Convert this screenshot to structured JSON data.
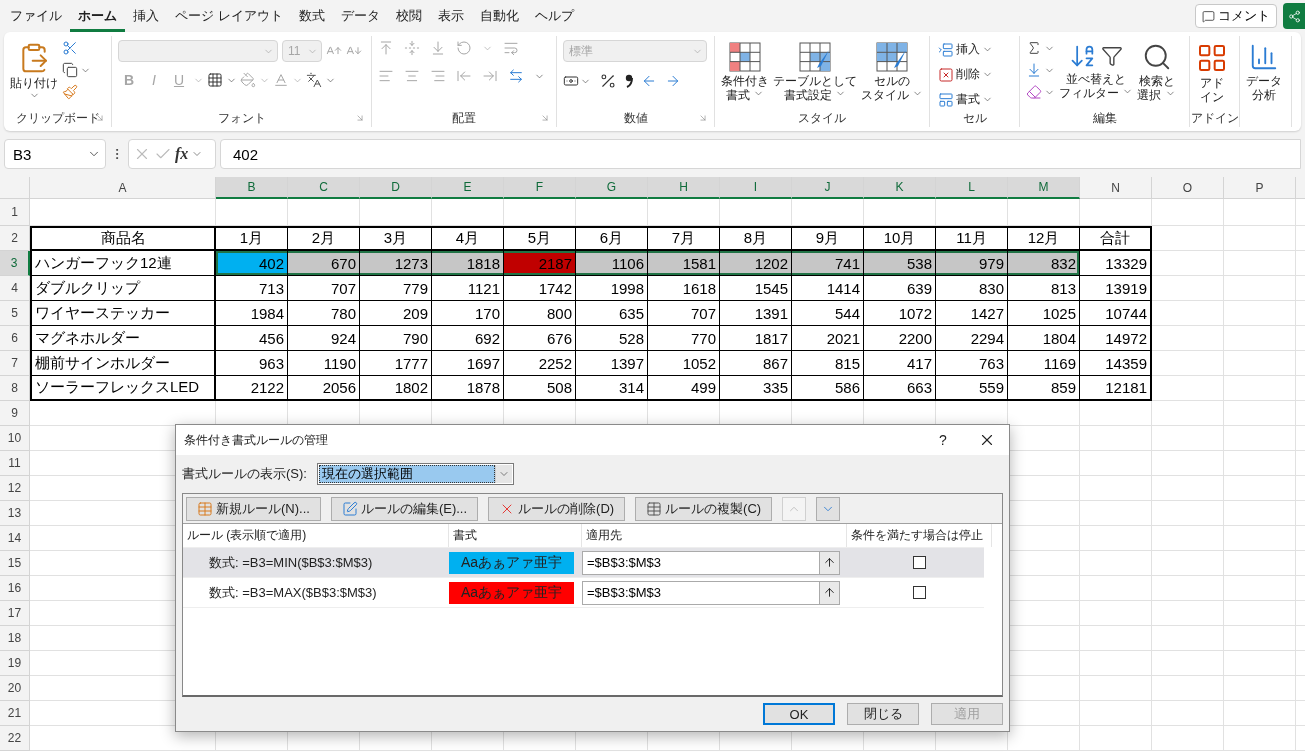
{
  "menu_tabs": [
    {
      "label": "ファイル",
      "selected": false
    },
    {
      "label": "ホーム",
      "selected": true
    },
    {
      "label": "挿入",
      "selected": false
    },
    {
      "label": "ページ レイアウト",
      "selected": false
    },
    {
      "label": "数式",
      "selected": false
    },
    {
      "label": "データ",
      "selected": false
    },
    {
      "label": "校閲",
      "selected": false
    },
    {
      "label": "表示",
      "selected": false
    },
    {
      "label": "自動化",
      "selected": false
    },
    {
      "label": "ヘルプ",
      "selected": false
    }
  ],
  "comment_button": "コメント",
  "ribbon": {
    "clipboard": {
      "paste": "貼り付け",
      "label": "クリップボード"
    },
    "font": {
      "disabled": true,
      "size": "11",
      "bold": "B",
      "italic": "I",
      "underline": "U",
      "label": "フォント"
    },
    "alignment": {
      "disabled": true,
      "label": "配置"
    },
    "number": {
      "format": "標準",
      "format_disabled": true,
      "label": "数値"
    },
    "styles": {
      "buttons": [
        {
          "kind": "conditional",
          "lines": [
            "条件付き",
            "書式"
          ]
        },
        {
          "kind": "table",
          "lines": [
            "テーブルとして",
            "書式設定"
          ]
        },
        {
          "kind": "cellstyle",
          "lines": [
            "セルの",
            "スタイル"
          ]
        }
      ],
      "label": "スタイル"
    },
    "cells": {
      "buttons": [
        {
          "kind": "insert",
          "label": "挿入"
        },
        {
          "kind": "delete",
          "label": "削除"
        },
        {
          "kind": "format",
          "label": "書式"
        }
      ],
      "label": "セル"
    },
    "editing": {
      "buttons": [
        {
          "kind": "sort",
          "lines": [
            "並べ替えと",
            "フィルター"
          ]
        },
        {
          "kind": "find",
          "lines": [
            "検索と",
            "選択"
          ]
        }
      ],
      "label": "編集"
    },
    "addins": {
      "buttons": [
        {
          "kind": "addin",
          "lines": [
            "アド",
            "イン"
          ]
        }
      ],
      "label": "アドイン"
    },
    "analysis": {
      "buttons": [
        {
          "kind": "analysis",
          "lines": [
            "データ",
            "分析"
          ]
        }
      ]
    }
  },
  "formula_bar": {
    "name_box": "B3",
    "fx": "fx",
    "value": "402"
  },
  "sheet": {
    "columns": [
      {
        "label": "A",
        "selected": false
      },
      {
        "label": "B",
        "selected": true
      },
      {
        "label": "C",
        "selected": true
      },
      {
        "label": "D",
        "selected": true
      },
      {
        "label": "E",
        "selected": true
      },
      {
        "label": "F",
        "selected": true
      },
      {
        "label": "G",
        "selected": true
      },
      {
        "label": "H",
        "selected": true
      },
      {
        "label": "I",
        "selected": true
      },
      {
        "label": "J",
        "selected": true
      },
      {
        "label": "K",
        "selected": true
      },
      {
        "label": "L",
        "selected": true
      },
      {
        "label": "M",
        "selected": true
      },
      {
        "label": "N",
        "selected": false
      },
      {
        "label": "O",
        "selected": false
      },
      {
        "label": "P",
        "selected": false
      }
    ],
    "rows": [
      {
        "number": "1",
        "kind": "empty",
        "selected": false,
        "cells": []
      },
      {
        "number": "2",
        "kind": "header",
        "selected": false,
        "cells": [
          "商品名",
          "1月",
          "2月",
          "3月",
          "4月",
          "5月",
          "6月",
          "7月",
          "8月",
          "9月",
          "10月",
          "11月",
          "12月",
          "合計"
        ]
      },
      {
        "number": "3",
        "kind": "data",
        "selected": true,
        "cells": [
          "ハンガーフック12連",
          {
            "text": "402",
            "color": "#00b0f0"
          },
          "670",
          "1273",
          "1818",
          {
            "text": "2187",
            "color": "#c00000"
          },
          "1106",
          "1581",
          "1202",
          "741",
          "538",
          "979",
          "832",
          "13329"
        ]
      },
      {
        "number": "4",
        "kind": "data",
        "selected": false,
        "cells": [
          "ダブルクリップ",
          "713",
          "707",
          "779",
          "1121",
          "1742",
          "1998",
          "1618",
          "1545",
          "1414",
          "639",
          "830",
          "813",
          "13919"
        ]
      },
      {
        "number": "5",
        "kind": "data",
        "selected": false,
        "cells": [
          "ワイヤーステッカー",
          "1984",
          "780",
          "209",
          "170",
          "800",
          "635",
          "707",
          "1391",
          "544",
          "1072",
          "1427",
          "1025",
          "10744"
        ]
      },
      {
        "number": "6",
        "kind": "data",
        "selected": false,
        "cells": [
          "マグネホルダー",
          "456",
          "924",
          "790",
          "692",
          "676",
          "528",
          "770",
          "1817",
          "2021",
          "2200",
          "2294",
          "1804",
          "14972"
        ]
      },
      {
        "number": "7",
        "kind": "data",
        "selected": false,
        "cells": [
          "棚前サインホルダー",
          "963",
          "1190",
          "1777",
          "1697",
          "2252",
          "1397",
          "1052",
          "867",
          "815",
          "417",
          "763",
          "1169",
          "14359"
        ]
      },
      {
        "number": "8",
        "kind": "data",
        "selected": false,
        "cells": [
          "ソーラーフレックスLED",
          "2122",
          "2056",
          "1802",
          "1878",
          "508",
          "314",
          "499",
          "335",
          "586",
          "663",
          "559",
          "859",
          "12181"
        ]
      },
      {
        "number": "9",
        "kind": "empty",
        "selected": false,
        "cells": []
      },
      {
        "number": "10",
        "kind": "empty",
        "selected": false,
        "cells": []
      },
      {
        "number": "11",
        "kind": "empty",
        "selected": false,
        "cells": []
      },
      {
        "number": "12",
        "kind": "empty",
        "selected": false,
        "cells": []
      },
      {
        "number": "13",
        "kind": "empty",
        "selected": false,
        "cells": []
      },
      {
        "number": "14",
        "kind": "empty",
        "selected": false,
        "cells": []
      },
      {
        "number": "15",
        "kind": "empty",
        "selected": false,
        "cells": []
      },
      {
        "number": "16",
        "kind": "empty",
        "selected": false,
        "cells": []
      },
      {
        "number": "17",
        "kind": "empty",
        "selected": false,
        "cells": []
      },
      {
        "number": "18",
        "kind": "empty",
        "selected": false,
        "cells": []
      },
      {
        "number": "19",
        "kind": "empty",
        "selected": false,
        "cells": []
      },
      {
        "number": "20",
        "kind": "empty",
        "selected": false,
        "cells": []
      },
      {
        "number": "21",
        "kind": "empty",
        "selected": false,
        "cells": []
      },
      {
        "number": "22",
        "kind": "empty",
        "selected": false,
        "cells": []
      }
    ]
  },
  "dialog": {
    "title": "条件付き書式ルールの管理",
    "help": "?",
    "scope_label": "書式ルールの表示(S):",
    "scope_value": "現在の選択範囲",
    "toolbar": [
      {
        "kind": "new",
        "label": "新規ルール(N)..."
      },
      {
        "kind": "edit",
        "label": "ルールの編集(E)..."
      },
      {
        "kind": "delete",
        "label": "ルールの削除(D)"
      },
      {
        "kind": "duplicate",
        "label": "ルールの複製(C)"
      },
      {
        "kind": "up",
        "disabled": true
      },
      {
        "kind": "down",
        "disabled": false
      }
    ],
    "columns": [
      "ルール (表示順で適用)",
      "書式",
      "適用先",
      "条件を満たす場合は停止"
    ],
    "rules": [
      {
        "rule": "数式: =B3=MIN($B$3:$M$3)",
        "preview": "Aaあぁアァ亜宇",
        "color": "#00b0f0",
        "applies_to": "=$B$3:$M$3",
        "stop": false,
        "selected": true
      },
      {
        "rule": "数式: =B3=MAX($B$3:$M$3)",
        "preview": "Aaあぁアァ亜宇",
        "color": "#ff0000",
        "applies_to": "=$B$3:$M$3",
        "stop": false,
        "selected": false
      }
    ],
    "buttons": [
      {
        "label": "OK",
        "default": true,
        "disabled": false
      },
      {
        "label": "閉じる",
        "default": false,
        "disabled": false
      },
      {
        "label": "適用",
        "default": false,
        "disabled": true
      }
    ]
  }
}
